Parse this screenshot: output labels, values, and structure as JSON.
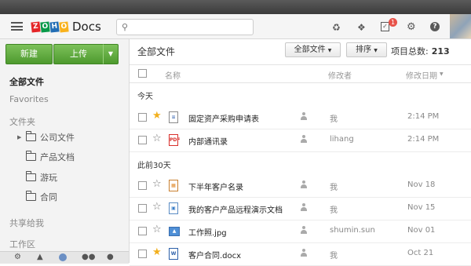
{
  "app": {
    "logo_letters": [
      "Z",
      "O",
      "H",
      "O"
    ],
    "logo_colors": [
      "#e42527",
      "#089949",
      "#226db4",
      "#f9b21d"
    ],
    "logo_product": "Docs"
  },
  "search": {
    "placeholder": ""
  },
  "topbar": {
    "icons": [
      "sync-icon",
      "dropbox-icon",
      "tasks-icon",
      "settings-icon",
      "help-icon"
    ],
    "tasks_badge": "1"
  },
  "sidebar": {
    "new_label": "新建",
    "upload_label": "上传",
    "all_files": "全部文件",
    "favorites": "Favorites",
    "folders_heading": "文件夹",
    "tree": [
      "公司文件",
      "产品文档",
      "游玩",
      "合同"
    ],
    "shared_with_me": "共享给我",
    "workspace": "工作区"
  },
  "main": {
    "title": "全部文件",
    "filter_label": "全部文件",
    "sort_label": "排序",
    "total_label": "项目总数:",
    "total_value": "213",
    "columns": {
      "name": "名称",
      "modifier": "修改者",
      "date": "修改日期"
    },
    "groups": [
      "今天",
      "此前30天"
    ],
    "rows": [
      {
        "name": "固定资产采购申请表",
        "starred": true,
        "type": "doc",
        "modifier": "我",
        "date": "2:14 PM"
      },
      {
        "name": "内部通讯录",
        "starred": false,
        "type": "pdf",
        "modifier": "lihang",
        "date": "2:14 PM"
      },
      {
        "name": "下半年客户名录",
        "starred": false,
        "type": "sheet",
        "modifier": "我",
        "date": "Nov 18"
      },
      {
        "name": "我的客户产品远程演示文档",
        "starred": false,
        "type": "show",
        "modifier": "我",
        "date": "Nov 15"
      },
      {
        "name": "工作照.jpg",
        "starred": false,
        "type": "image",
        "modifier": "shumin.sun",
        "date": "Nov 01"
      },
      {
        "name": "客户合同.docx",
        "starred": true,
        "type": "word",
        "modifier": "我",
        "date": "Oct 21"
      }
    ]
  },
  "colors": {
    "accent_green": "#5aa83a",
    "star_gold": "#f2b01e",
    "badge_red": "#e8534a"
  }
}
